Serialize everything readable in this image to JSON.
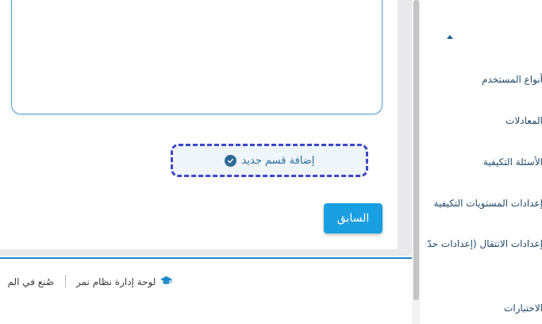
{
  "main": {
    "add_section_label": "إضافة قسم جديد",
    "prev_button_label": "السابق"
  },
  "footer": {
    "brand": "لوحة إدارة نظام نمر",
    "made": "صُنع في الم"
  },
  "sidebar": {
    "items": [
      {
        "label": "أنواع المستخدم"
      },
      {
        "label": "المعادلات"
      },
      {
        "label": "الأسئلة التكيفية"
      },
      {
        "label": "إعدادات المستويات التكيفية"
      },
      {
        "label": "إعدادات الانتقال (إعدادات حدّ"
      },
      {
        "label": "الاختبارات"
      }
    ]
  },
  "icons": {
    "check": "check-circle-icon",
    "brand": "graduation-cap-icon",
    "caret": "caret-up-icon"
  },
  "colors": {
    "primary": "#1a9fe0",
    "accent_dashed": "#3f46c8",
    "footer_line": "#1d86c4"
  }
}
